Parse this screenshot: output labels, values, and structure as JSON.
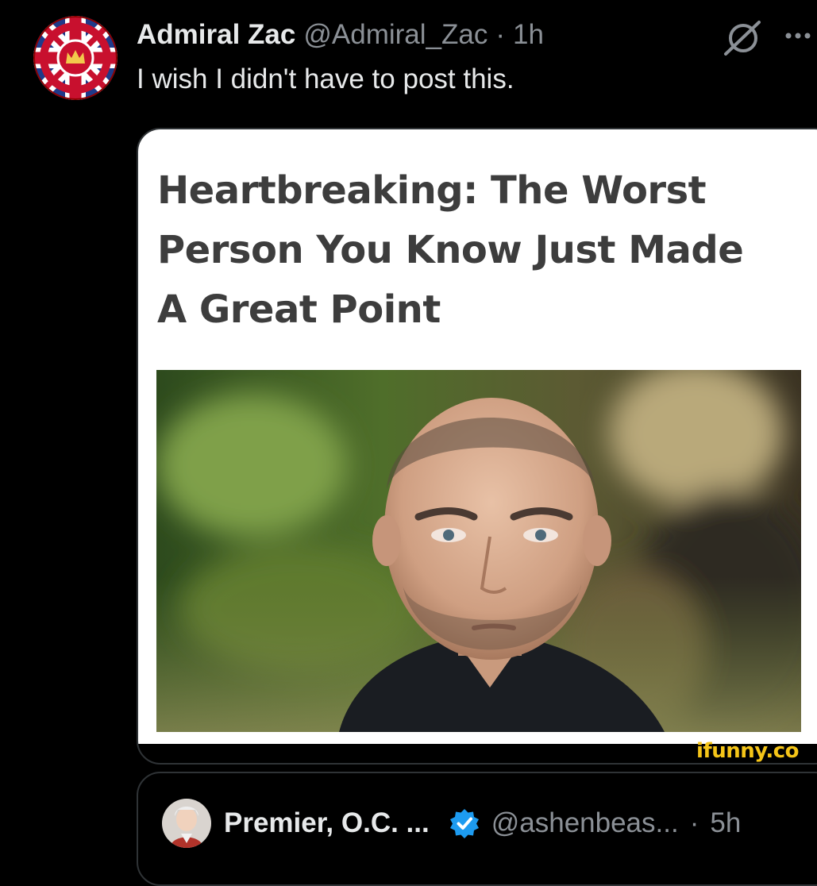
{
  "tweet": {
    "author": {
      "display_name": "Admiral Zac",
      "handle": "@Admiral_Zac",
      "avatar_icon": "union-jack-crown-icon"
    },
    "separator": "·",
    "time": "1h",
    "text": "I wish I didn't have to post this."
  },
  "actions": {
    "grok_icon": "grok-icon",
    "more_icon": "more-options-icon"
  },
  "media": {
    "headline_lines": [
      "Heartbreaking: The Worst",
      "Person You Know Just Made",
      "A Great Point"
    ],
    "watermark": "ifunny.co",
    "headline_color": "#3d3d3d",
    "watermark_color": "#f5c518"
  },
  "quoted_tweet": {
    "display_name": "Premier, O.C. ...",
    "verified_icon": "verified-badge-icon",
    "handle": "@ashenbeas...",
    "separator": "·",
    "time": "5h"
  },
  "colors": {
    "background": "#000000",
    "text": "#e7e9ea",
    "muted": "#8b9096",
    "border": "#2f3336",
    "verified": "#1d9bf0"
  }
}
